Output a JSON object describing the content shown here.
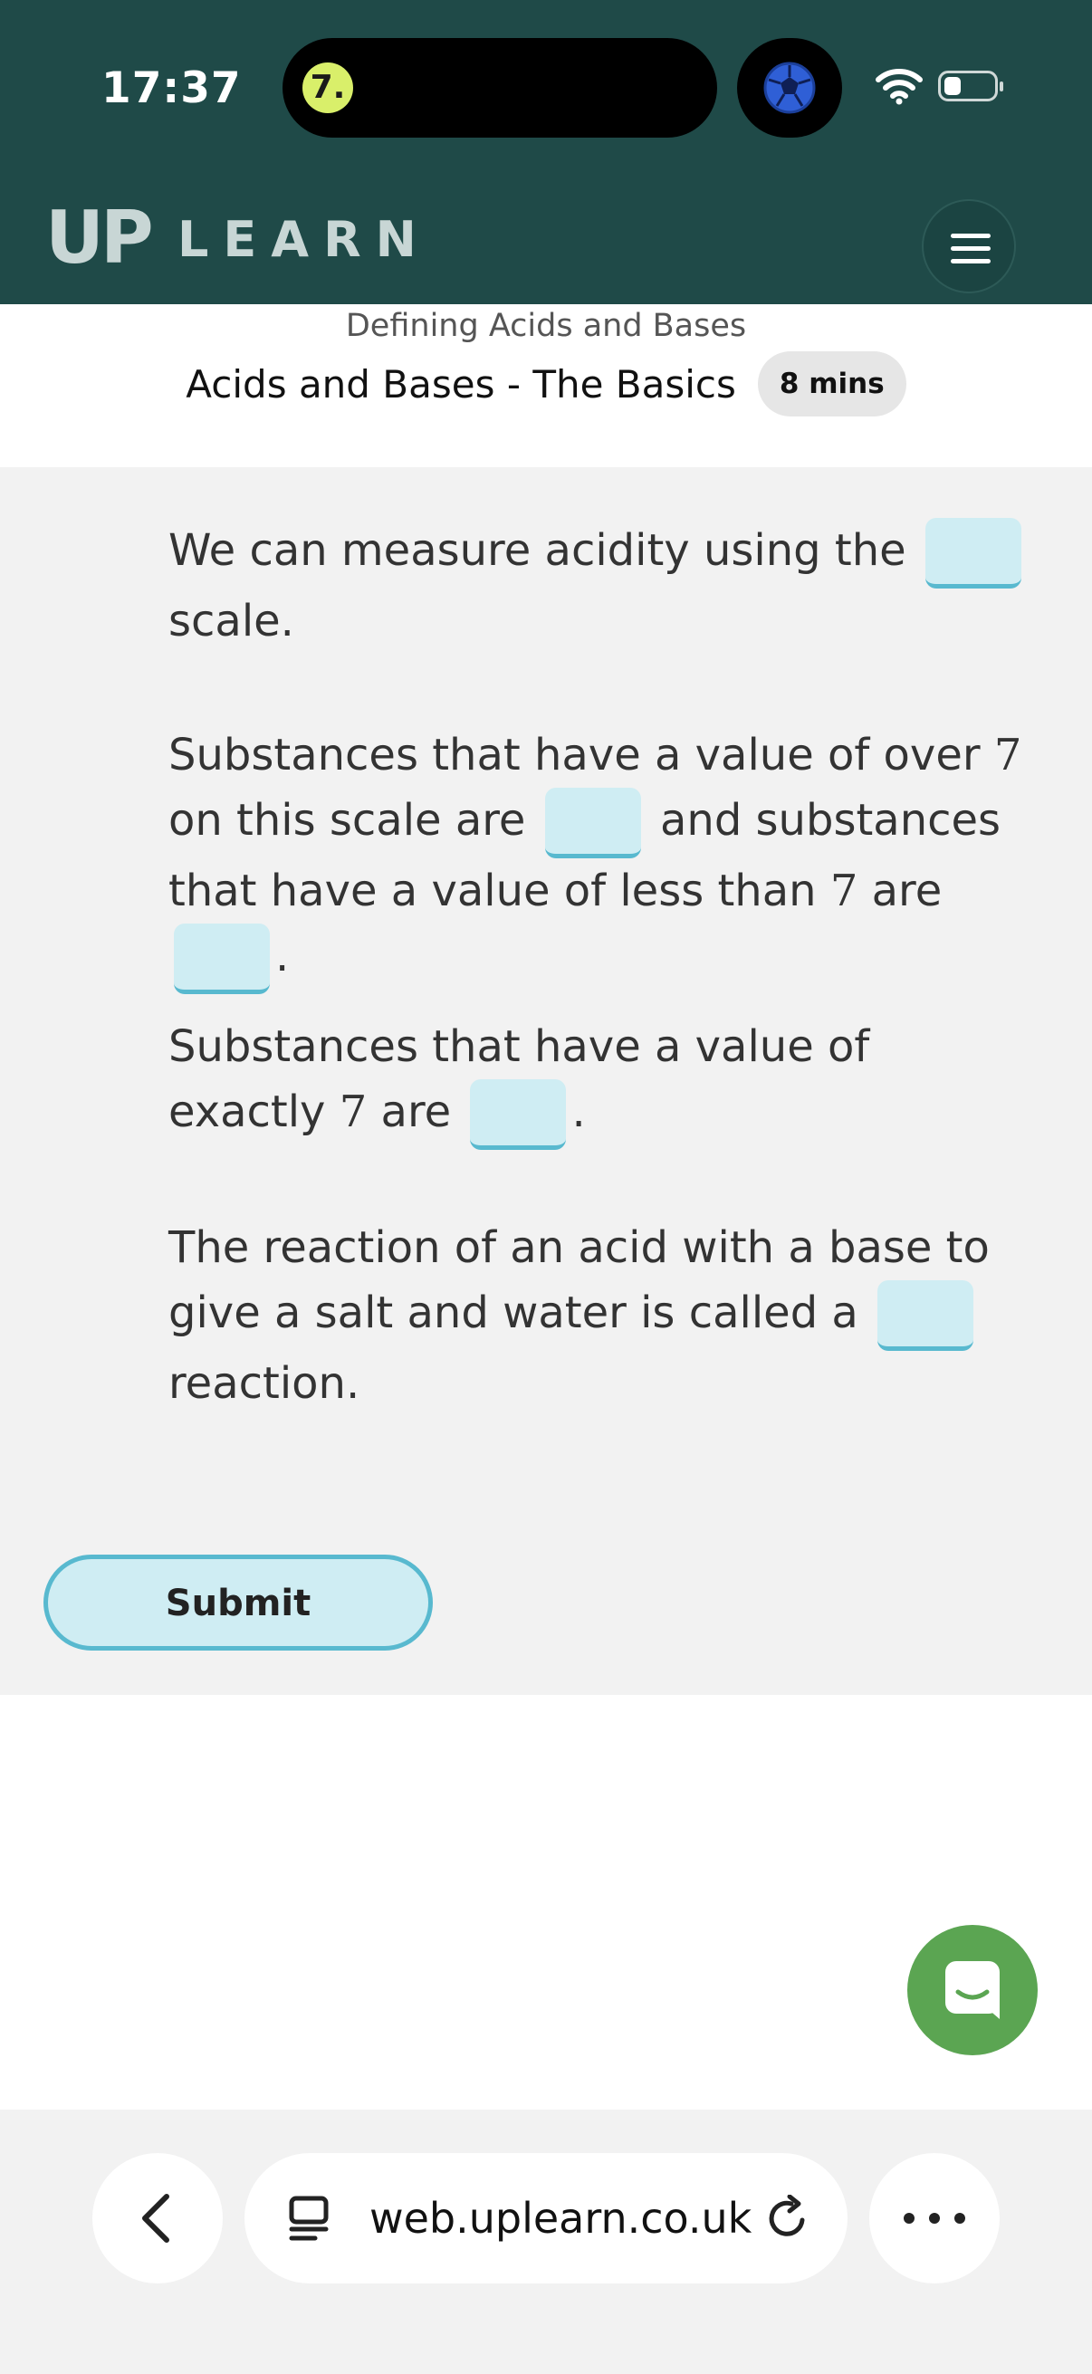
{
  "status_bar": {
    "time": "17:37",
    "island_app_glyph": "7.",
    "icons": [
      "wifi-icon",
      "battery-icon",
      "soccer-ball-icon"
    ]
  },
  "header": {
    "logo_mark": "UP",
    "logo_word": "LEARN",
    "menu_icon": "hamburger-icon",
    "background": "#1f4a48"
  },
  "lesson": {
    "breadcrumb": "Defining Acids and Bases",
    "title": "Acids and Bases - The Basics",
    "duration": "8 mins"
  },
  "question": {
    "p1": {
      "a": "We can measure acidity using the",
      "b": "scale."
    },
    "p2": {
      "a": "Substances that have a value of over",
      "n1": "7",
      "b": "on this scale are",
      "c": "and substances that have a value of less than",
      "n2": "7",
      "d": "are",
      "e": "."
    },
    "p3": {
      "a": "Substances that have a value of exactly",
      "n": "7",
      "b": "are",
      "c": "."
    },
    "p4": {
      "a": "The reaction of an acid with a base to give a salt and water is called a",
      "b": "reaction."
    },
    "submit_label": "Submit",
    "blank_color": "#cfedf3",
    "accent": "#58b9cf"
  },
  "chat": {
    "icon": "chat-bubble-icon",
    "color": "#5ba552"
  },
  "browser": {
    "url": "web.uplearn.co.uk",
    "icons": [
      "back-arrow-icon",
      "tabs-icon",
      "reload-icon",
      "more-dots-icon"
    ]
  }
}
